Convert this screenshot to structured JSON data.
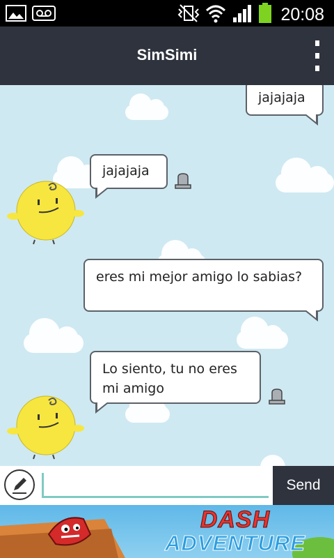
{
  "status_bar": {
    "time": "20:08",
    "icons": [
      "gallery-icon",
      "voicemail-icon",
      "vibrate-mute-icon",
      "wifi-icon",
      "signal-icon",
      "battery-icon"
    ]
  },
  "app_bar": {
    "title": "SimSimi",
    "menu_icon": "overflow-menu-icon"
  },
  "chat": {
    "messages": [
      {
        "sender": "user",
        "text": "jajajaja"
      },
      {
        "sender": "simsimi",
        "text": "jajajaja"
      },
      {
        "sender": "user",
        "text": "eres mi mejor amigo lo sabias?"
      },
      {
        "sender": "simsimi",
        "text": "Lo siento, tu no eres mi amigo"
      }
    ]
  },
  "input": {
    "value": "",
    "send_label": "Send",
    "edit_icon": "pencil-icon"
  },
  "ad": {
    "title_line1": "DASH",
    "title_line2": "ADVENTURE"
  },
  "colors": {
    "app_bar": "#2f333d",
    "chat_background": "#cfe9f2",
    "avatar": "#f7e63f",
    "input_accent": "#7fc9c3",
    "battery": "#7ed321"
  }
}
